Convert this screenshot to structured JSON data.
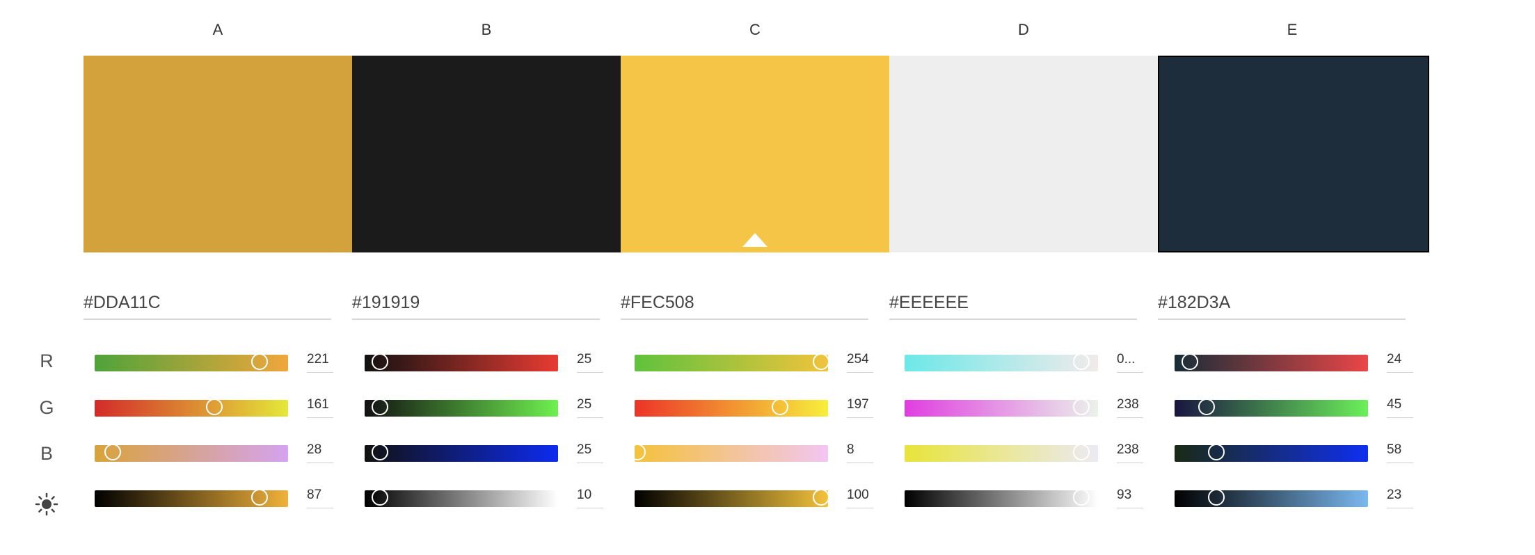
{
  "columns": [
    {
      "label": "A",
      "color": "#D4A23D",
      "hex": "#DDA11C",
      "r": "221",
      "g": "161",
      "b": "28",
      "brightness": "87"
    },
    {
      "label": "B",
      "color": "#1B1B1B",
      "hex": "#191919",
      "r": "25",
      "g": "25",
      "b": "25",
      "brightness": "10"
    },
    {
      "label": "C",
      "color": "#F4C546",
      "hex": "#FEC508",
      "r": "254",
      "g": "197",
      "b": "8",
      "brightness": "100"
    },
    {
      "label": "D",
      "color": "#EEEEEE",
      "hex": "#EEEEEE",
      "r": "0...",
      "g": "238",
      "b": "238",
      "brightness": "93"
    },
    {
      "label": "E",
      "color": "#1E2D3B",
      "hex": "#182D3A",
      "r": "24",
      "g": "45",
      "b": "58",
      "brightness": "23"
    }
  ],
  "rows": {
    "r": "R",
    "g": "G",
    "b": "B",
    "brightness_icon": "sun-icon"
  }
}
